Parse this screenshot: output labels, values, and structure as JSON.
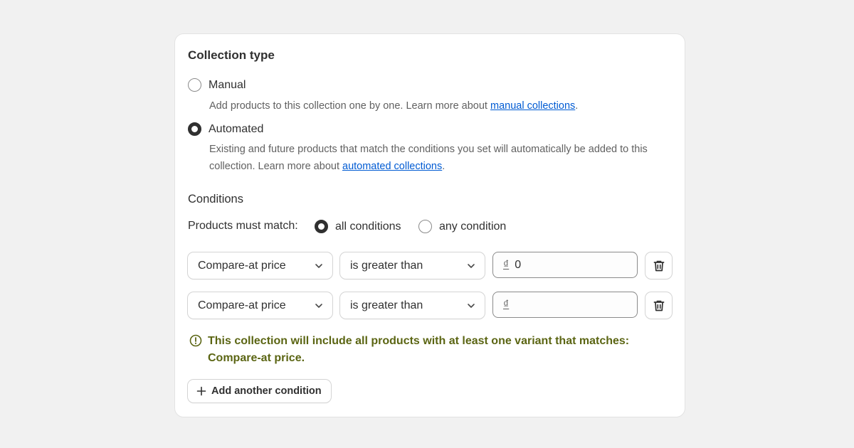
{
  "card": {
    "title": "Collection type",
    "options": [
      {
        "label": "Manual",
        "checked": false,
        "help_text": "Add products to this collection one by one. Learn more about ",
        "help_link": "manual collections",
        "help_suffix": "."
      },
      {
        "label": "Automated",
        "checked": true,
        "help_text": "Existing and future products that match the conditions you set will automatically be added to this collection. Learn more about ",
        "help_link": "automated collections",
        "help_suffix": "."
      }
    ]
  },
  "conditions": {
    "title": "Conditions",
    "match_label": "Products must match:",
    "match_options": [
      {
        "label": "all conditions",
        "checked": true
      },
      {
        "label": "any condition",
        "checked": false
      }
    ],
    "rows": [
      {
        "field": "Compare-at price",
        "operator": "is greater than",
        "currency": "₫",
        "value": "0",
        "delete_icon": "trash-icon"
      },
      {
        "field": "Compare-at price",
        "operator": "is greater than",
        "currency": "₫",
        "value": "",
        "delete_icon": "trash-icon"
      }
    ],
    "info_message": "This collection will include all products with at least one variant that matches: Compare-at price.",
    "info_icon": "alert-circle-icon",
    "add_button": "Add another condition",
    "add_icon": "plus-icon"
  },
  "colors": {
    "link": "#005bd3",
    "info_text": "#5b6513",
    "text": "#303030",
    "muted": "#616161"
  }
}
